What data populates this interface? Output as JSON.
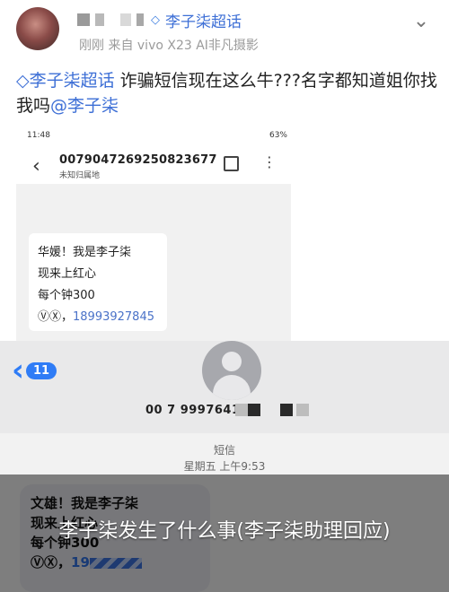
{
  "post": {
    "author_verified_name": "李子柒超话",
    "meta": "刚刚  来自 vivo X23 AI非凡摄影",
    "text_mention": "李子柒超话",
    "text_body": " 诈骗短信现在这么牛???名字都知道姐你找我吗",
    "text_at": "@李子柒"
  },
  "screenshot1": {
    "status_left": "11:48",
    "status_right": "63%",
    "sender_number": "0079047269250823677",
    "sender_sub": "未知归属地",
    "bubble_lines": [
      "华媛！我是李子柒",
      "现来上红心",
      "每个钟300"
    ],
    "bubble_phone_prefix": "ⓋⓍ，",
    "bubble_phone": "18993927845"
  },
  "screenshot2": {
    "back_count": "11",
    "contact_number": "00 7 9997641",
    "sms_label": "短信",
    "sms_time": "星期五 上午9:53",
    "bubble_lines": [
      "文雄！我是李子柒",
      "现来上红心",
      "每个钟300"
    ],
    "bubble_phone_prefix": "ⓋⓍ，",
    "bubble_phone_start": "19"
  },
  "caption": "李子柒发生了什么事(李子柒助理回应)",
  "colors": {
    "link_blue": "#3d6fd6",
    "ios_blue": "#2f7cf6"
  }
}
